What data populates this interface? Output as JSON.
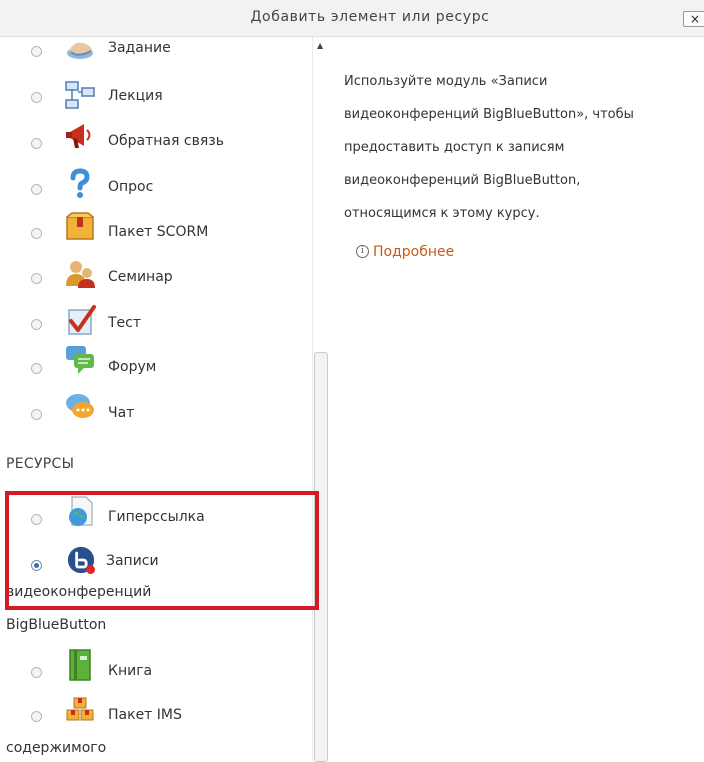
{
  "dialog": {
    "title": "Добавить элемент или ресурс",
    "close_label": "×"
  },
  "activities": [
    {
      "label": "Задание",
      "icon": "assignment-hand-icon"
    },
    {
      "label": "Лекция",
      "icon": "lesson-tree-icon"
    },
    {
      "label": "Обратная связь",
      "icon": "feedback-megaphone-icon"
    },
    {
      "label": "Опрос",
      "icon": "question-mark-icon"
    },
    {
      "label": "Пакет SCORM",
      "icon": "scorm-package-icon"
    },
    {
      "label": "Семинар",
      "icon": "workshop-people-icon"
    },
    {
      "label": "Тест",
      "icon": "quiz-checkmark-icon"
    },
    {
      "label": "Форум",
      "icon": "forum-bubbles-icon"
    },
    {
      "label": "Чат",
      "icon": "chat-bubble-icon"
    }
  ],
  "resources_heading": "РЕСУРСЫ",
  "resources": {
    "url": {
      "label": "Гиперссылка",
      "icon": "url-globe-icon"
    },
    "bbb": {
      "label_line1": "Записи",
      "label_line2": "видеоконференций",
      "label_line3": "BigBlueButton",
      "icon": "bigbluebutton-recordings-icon",
      "selected": true
    },
    "book": {
      "label": "Книга",
      "icon": "book-icon"
    },
    "ims": {
      "label_line1": "Пакет IMS",
      "label_line2": "содержимого",
      "icon": "ims-package-icon"
    }
  },
  "description": {
    "line1": "Используйте модуль «Записи",
    "line2": "видеоконференций BigBlueButton», чтобы",
    "line3": "предоставить доступ к записям",
    "line4": "видеоконференций BigBlueButton,",
    "line5": "относящимся к этому курсу.",
    "more_link": "Подробнее"
  },
  "colors": {
    "highlight": "#d61a25",
    "link": "#c85a17",
    "radio_selected": "#3a6ea5"
  }
}
